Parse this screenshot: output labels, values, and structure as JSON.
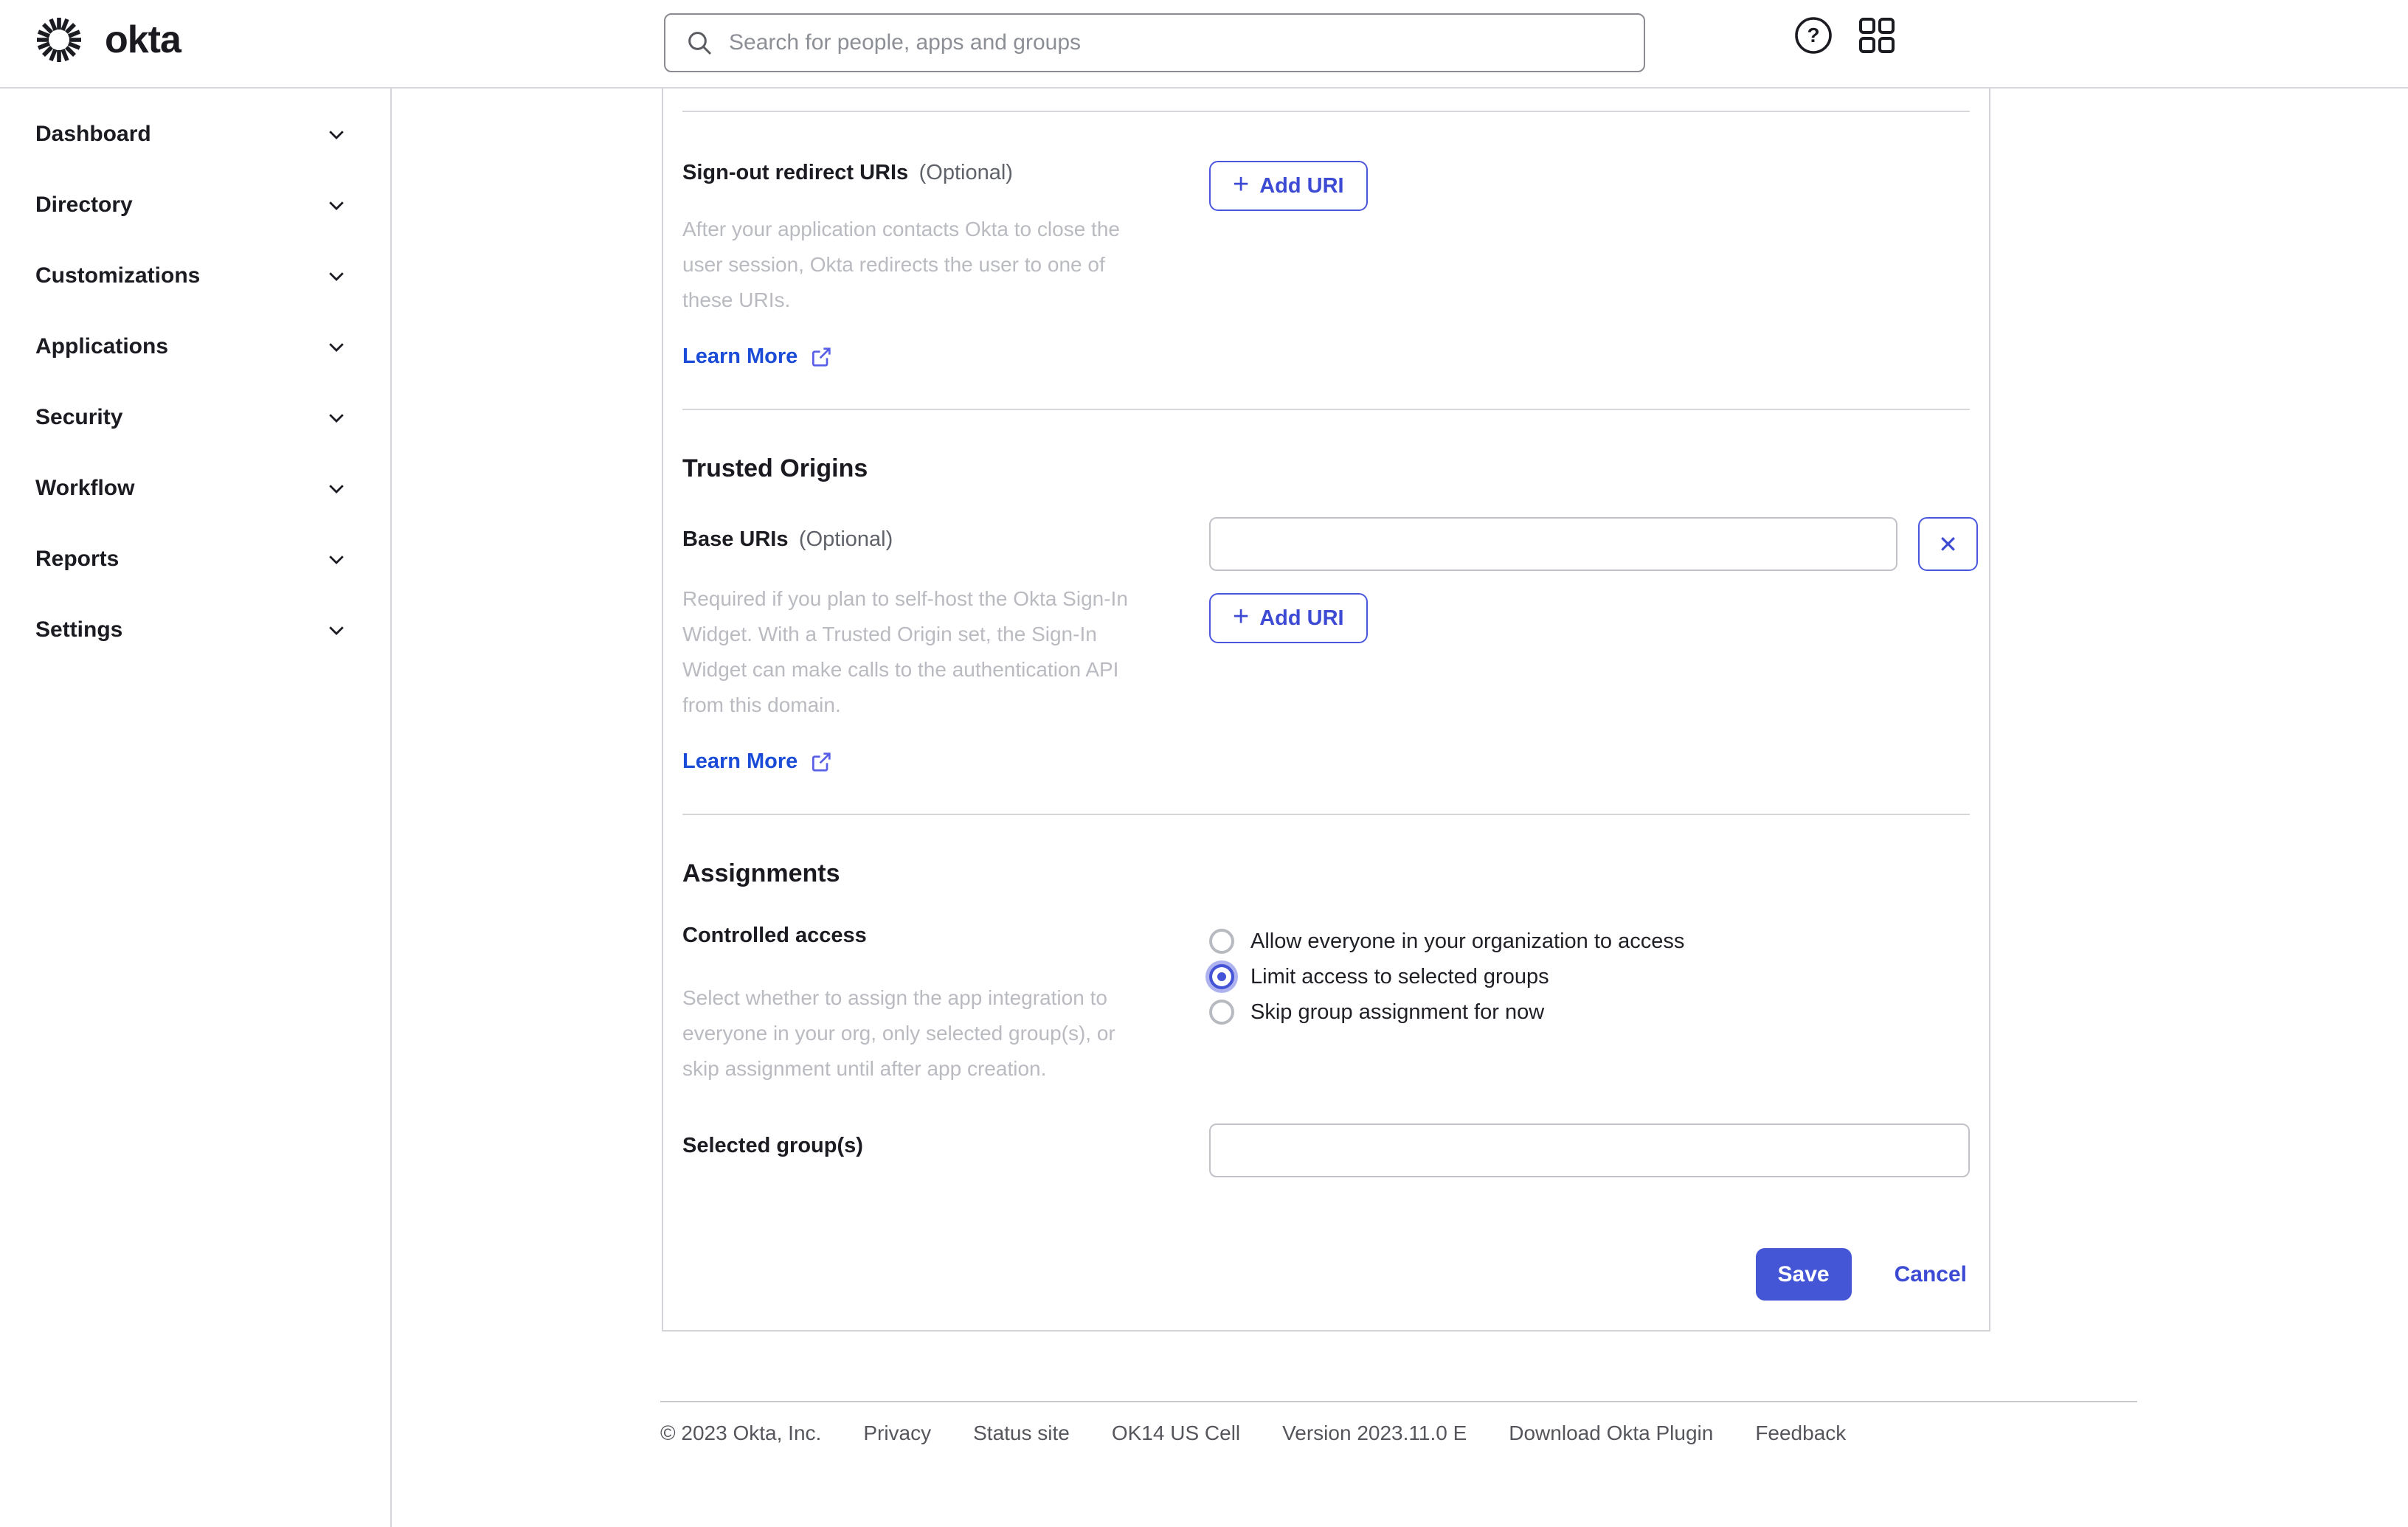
{
  "header": {
    "brand": "okta",
    "search": {
      "placeholder": "Search for people, apps and groups",
      "value": ""
    }
  },
  "sidebar": {
    "items": [
      {
        "label": "Dashboard"
      },
      {
        "label": "Directory"
      },
      {
        "label": "Customizations"
      },
      {
        "label": "Applications"
      },
      {
        "label": "Security"
      },
      {
        "label": "Workflow"
      },
      {
        "label": "Reports"
      },
      {
        "label": "Settings"
      }
    ]
  },
  "main": {
    "signout_section": {
      "label": "Sign-out redirect URIs",
      "optional": "(Optional)",
      "description": [
        "After your application contacts Okta to close the",
        "user session, Okta redirects the user to one of",
        "these URIs."
      ],
      "learn_more": "Learn More",
      "add_uri": "Add URI"
    },
    "trusted_origins": {
      "heading": "Trusted Origins",
      "base_uris_label": "Base URIs",
      "optional": "(Optional)",
      "base_uri_value": "",
      "description": [
        "Required if you plan to self-host the Okta Sign-In",
        "Widget. With a Trusted Origin set, the Sign-In",
        "Widget can make calls to the authentication API",
        "from this domain."
      ],
      "learn_more": "Learn More",
      "add_uri": "Add URI",
      "remove_label": "✕"
    },
    "assignments": {
      "heading": "Assignments",
      "controlled_access": {
        "label": "Controlled access",
        "description": [
          "Select whether to assign the app integration to",
          "everyone in your org, only selected group(s), or",
          "skip assignment until after app creation."
        ],
        "options": [
          {
            "label": "Allow everyone in your organization to access",
            "selected": false
          },
          {
            "label": "Limit access to selected groups",
            "selected": true
          },
          {
            "label": "Skip group assignment for now",
            "selected": false
          }
        ]
      },
      "selected_groups": {
        "label": "Selected group(s)",
        "value": ""
      }
    },
    "actions": {
      "save": "Save",
      "cancel": "Cancel"
    }
  },
  "footer": {
    "items": [
      "© 2023 Okta, Inc.",
      "Privacy",
      "Status site",
      "OK14 US Cell",
      "Version 2023.11.0 E",
      "Download Okta Plugin",
      "Feedback"
    ]
  },
  "icons": {
    "logo": "okta-sunburst-icon",
    "search": "magnifier-icon",
    "help": "question-circle-icon",
    "apps": "grid-squares-icon",
    "nav": "chevron-down-icon",
    "learn_more": "external-link-icon",
    "add": "plus-icon",
    "remove": "x-icon"
  },
  "colors": {
    "accent_indigo": "#4456d6",
    "link_blue": "#1a4cd8",
    "text_dark": "#1b1b22",
    "muted_description": "#b9bbc1",
    "footer_text": "#55565c",
    "border_gray": "#d6d6da"
  }
}
